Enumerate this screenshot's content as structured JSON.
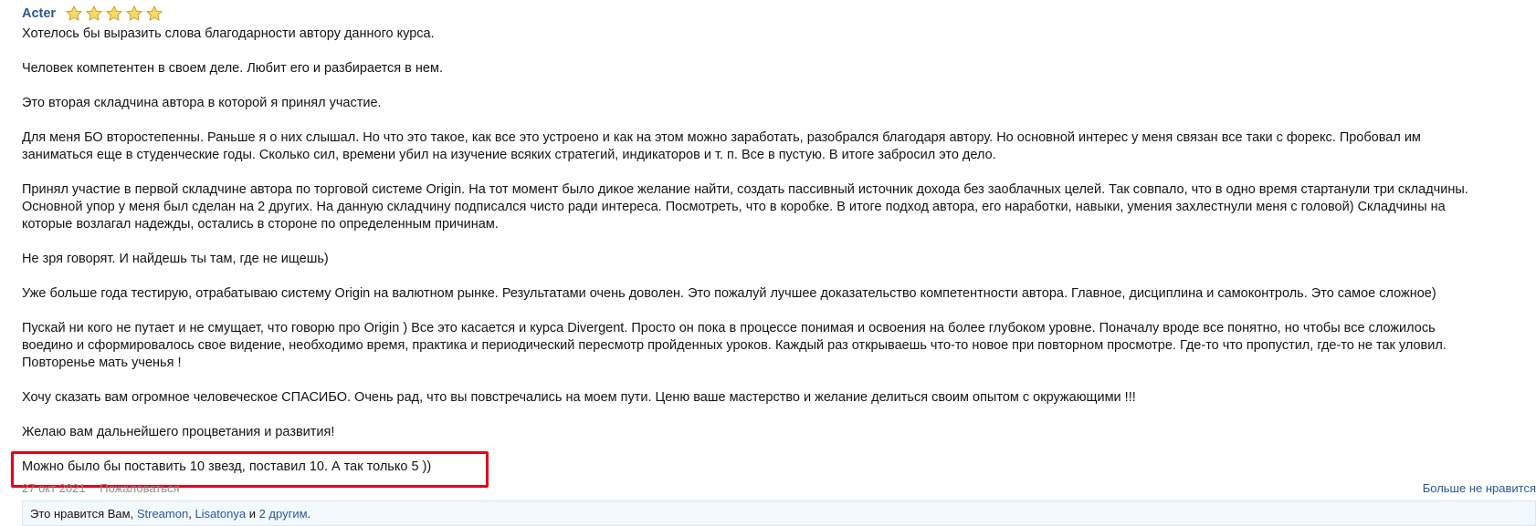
{
  "review": {
    "author": "Acter",
    "rating": 5,
    "rating_max": 5,
    "star_icon": "star-icon",
    "colors": {
      "author": "#2b5797",
      "star_fill": "#f8d86a",
      "star_stroke": "#c9a12b",
      "highlight_border": "#e3001b",
      "muted": "#8c8c8c",
      "link": "#2b5797"
    },
    "paragraphs": [
      {
        "lines": [
          "Хотелось бы выразить слова благодарности автору данного курса."
        ]
      },
      {
        "lines": [
          "Человек компетентен в своем деле. Любит его и разбирается в нем."
        ]
      },
      {
        "lines": [
          "Это вторая складчина автора в которой я принял участие."
        ]
      },
      {
        "lines": [
          "Для меня БО второстепенны. Раньше я о них слышал. Но что это такое, как все это устроено и как на этом можно заработать, разобрался благодаря автору. Но основной интерес у меня связан все таки с форекс. Пробовал им",
          "заниматься еще в студенческие годы. Сколько сил, времени убил на изучение всяких стратегий, индикаторов и т. п. Все в пустую. В итоге забросил это дело."
        ]
      },
      {
        "lines": [
          "Принял участие в первой складчине автора по торговой системе Origin. На тот момент было дикое желание найти, создать пассивный источник дохода без заоблачных целей. Так совпало, что в одно время стартанули три складчины.",
          "Основной упор у меня был сделан на 2 других. На данную складчину подписался чисто ради интереса. Посмотреть, что в коробке. В итоге подход автора, его наработки, навыки, умения захлестнули меня с головой) Складчины на",
          "которые возлагал надежды, остались в стороне по определенным причинам."
        ]
      },
      {
        "lines": [
          "Не зря говорят. И найдешь ты там, где не ищешь)"
        ]
      },
      {
        "lines": [
          "Уже больше года тестирую, отрабатываю систему Origin на валютном рынке. Результатами очень доволен. Это пожалуй лучшее доказательство компетентности автора. Главное, дисциплина и самоконтроль. Это самое сложное)"
        ]
      },
      {
        "lines": [
          "Пускай ни кого не путает и не смущает, что говорю про Origin ) Все это касается и курса Divergent. Просто он пока в процессе понимая и освоения на более глубоком уровне. Поначалу вроде все понятно, но чтобы все сложилось",
          "воедино и сформировалось свое видение, необходимо время, практика и периодический пересмотр пройденных уроков. Каждый раз открываешь что-то новое при повторном просмотре. Где-то что пропустил, где-то не так уловил.",
          "Повторенье мать ученья !"
        ]
      },
      {
        "lines": [
          "Хочу сказать вам огромное человеческое СПАСИБО. Очень рад, что вы повстречались на моем пути. Ценю ваше мастерство и желание делиться своим опытом с окружающими !!!"
        ]
      },
      {
        "lines": [
          "Желаю вам дальнейшего процветания и развития!"
        ]
      },
      {
        "lines": [
          "Можно было бы поставить 10 звезд, поставил 10. А так только 5 ))"
        ]
      }
    ],
    "footer": {
      "date": "27 окт 2021",
      "report_label": "Пожаловаться",
      "unlike_label": "Больше не нравится"
    },
    "likes": {
      "prefix": "Это нравится Вам, ",
      "users": [
        "Streamon",
        "Lisatonya"
      ],
      "separator": ", ",
      "conjunction": " и ",
      "others": "2 другим",
      "suffix": "."
    }
  }
}
